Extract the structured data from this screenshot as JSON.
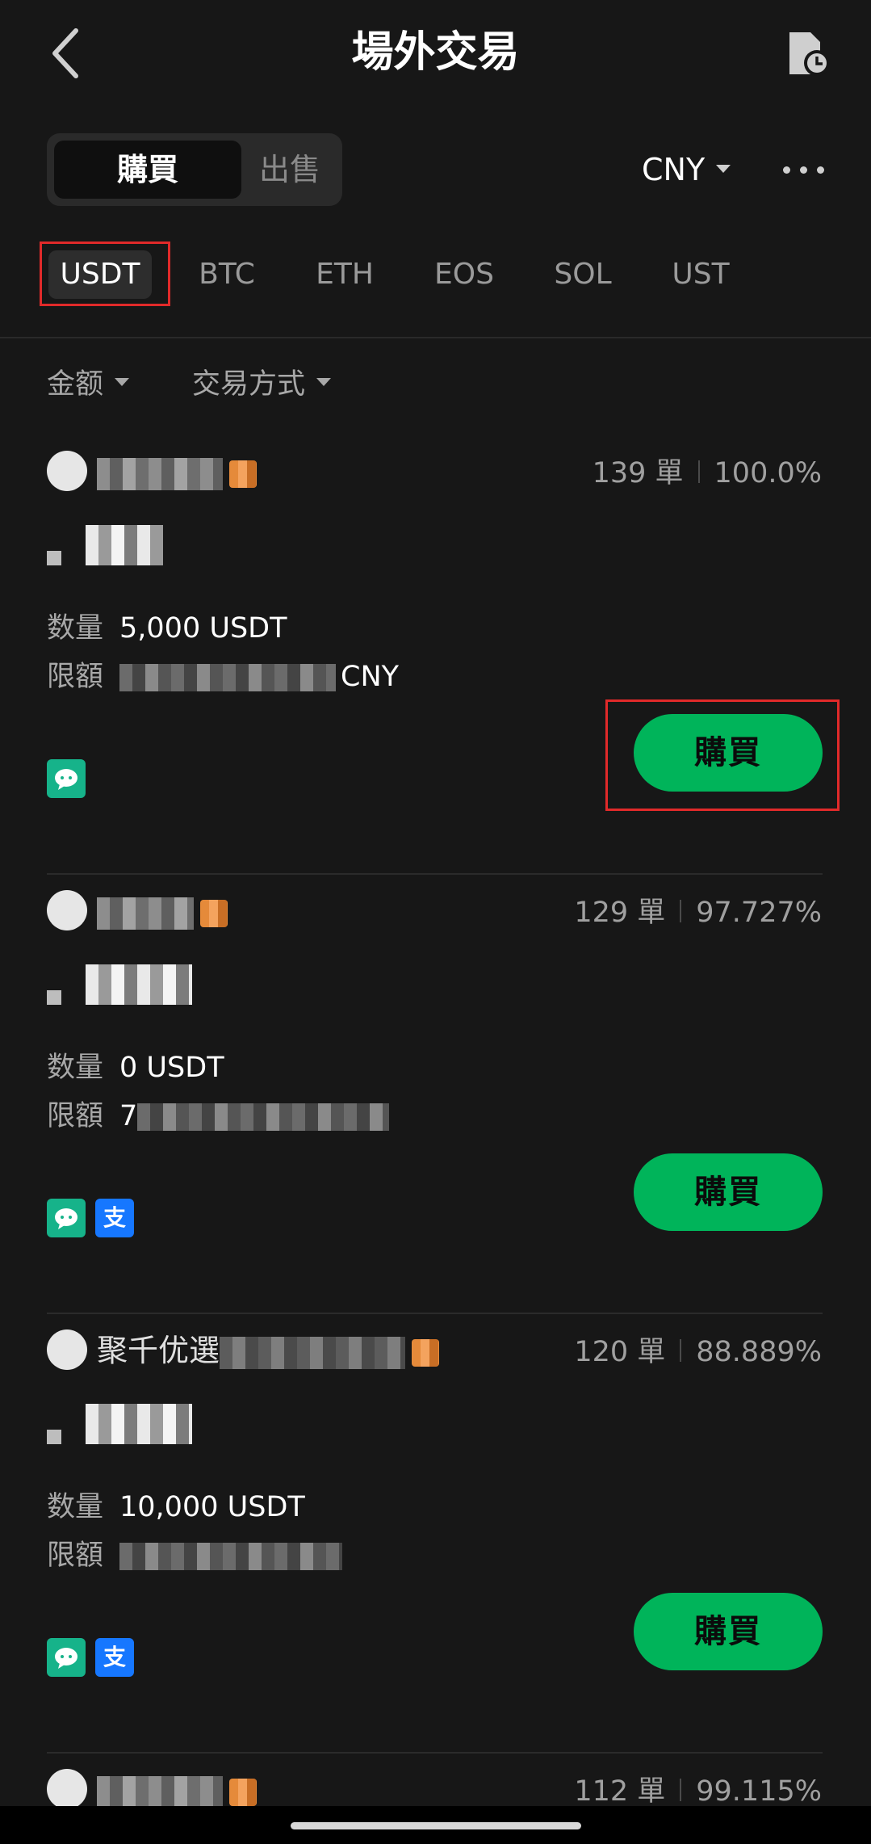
{
  "header": {
    "title": "場外交易",
    "back_icon": "chevron-left-icon",
    "history_icon": "order-history-icon"
  },
  "segment": {
    "buy_label": "購買",
    "sell_label": "出售",
    "selected": "buy"
  },
  "currency": {
    "value": "CNY"
  },
  "coins": [
    {
      "label": "USDT",
      "active": true
    },
    {
      "label": "BTC",
      "active": false
    },
    {
      "label": "ETH",
      "active": false
    },
    {
      "label": "EOS",
      "active": false
    },
    {
      "label": "SOL",
      "active": false
    },
    {
      "label": "UST",
      "active": false
    }
  ],
  "filters": {
    "amount": "金额",
    "payment": "交易方式"
  },
  "listings": [
    {
      "merchant": "",
      "orders": "139 單",
      "completion": "100.0%",
      "quantity_label": "数量",
      "quantity": "5,000 USDT",
      "limit_label": "限額",
      "limit_suffix": "CNY",
      "payments": [
        "wechat"
      ],
      "buy_label": "購買"
    },
    {
      "merchant": "",
      "orders": "129 單",
      "completion": "97.727%",
      "quantity_label": "数量",
      "quantity": "0 USDT",
      "limit_label": "限額",
      "limit_prefix": "7",
      "payments": [
        "wechat",
        "alipay"
      ],
      "buy_label": "購買"
    },
    {
      "merchant": "聚千优選",
      "orders": "120 單",
      "completion": "88.889%",
      "quantity_label": "数量",
      "quantity": "10,000 USDT",
      "limit_label": "限額",
      "payments": [
        "wechat",
        "alipay"
      ],
      "buy_label": "購買"
    },
    {
      "merchant": "",
      "orders": "112 單",
      "completion": "99.115%"
    }
  ],
  "pay_icons": {
    "alipay_glyph": "支"
  },
  "colors": {
    "accent_green": "#00b45a",
    "highlight_red": "#e12a2a",
    "background": "#171717"
  }
}
